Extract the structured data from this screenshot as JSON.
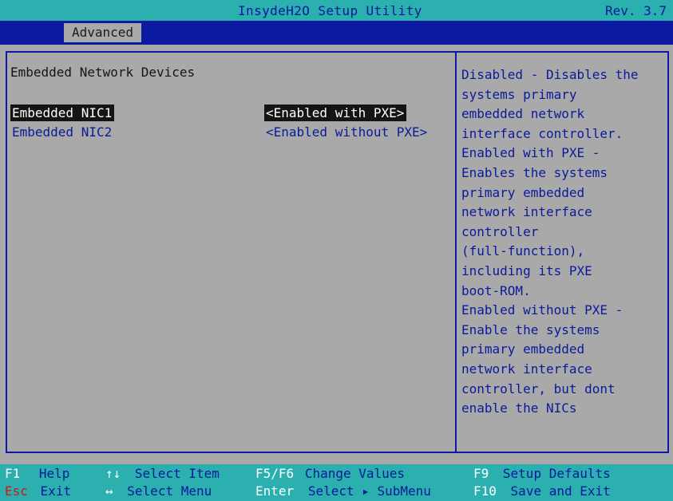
{
  "header": {
    "title": "InsydeH2O Setup Utility",
    "revision": "Rev. 3.7"
  },
  "menu": {
    "tabs": [
      {
        "label": "Advanced",
        "active": true
      }
    ]
  },
  "page": {
    "section_title": "Embedded Network Devices",
    "items": [
      {
        "label": "Embedded NIC1",
        "value": "<Enabled with PXE>",
        "selected": true
      },
      {
        "label": "Embedded NIC2",
        "value": "<Enabled without PXE>",
        "selected": false
      }
    ]
  },
  "help": {
    "lines": [
      "Disabled - Disables the",
      "systems primary",
      "embedded network",
      "interface controller.",
      "Enabled with PXE -",
      "Enables the systems",
      "primary embedded",
      "network interface",
      "controller",
      "(full-function),",
      "including its PXE",
      "boot-ROM.",
      "Enabled without PXE -",
      "Enable the systems",
      "primary embedded",
      "network interface",
      "controller, but dont",
      "enable the NICs"
    ]
  },
  "footer": {
    "row1": [
      {
        "key": "F1",
        "action": "Help"
      },
      {
        "key": "↑↓",
        "action": "Select Item"
      },
      {
        "key": "F5/F6",
        "action": "Change Values"
      },
      {
        "key": "F9",
        "action": "Setup Defaults"
      }
    ],
    "row2": [
      {
        "key": "Esc",
        "action": "Exit"
      },
      {
        "key": "↔",
        "action": "Select Menu"
      },
      {
        "key": "Enter",
        "action": "Select ▸ SubMenu"
      },
      {
        "key": "F10",
        "action": "Save and Exit"
      }
    ]
  },
  "colors": {
    "header_bg": "#2bafaf",
    "menubar_bg": "#0b1aa0",
    "body_bg": "#a9a9a9",
    "text_blue": "#0a1a9a",
    "selected_bg": "#141414",
    "esc_key": "#d01818"
  }
}
